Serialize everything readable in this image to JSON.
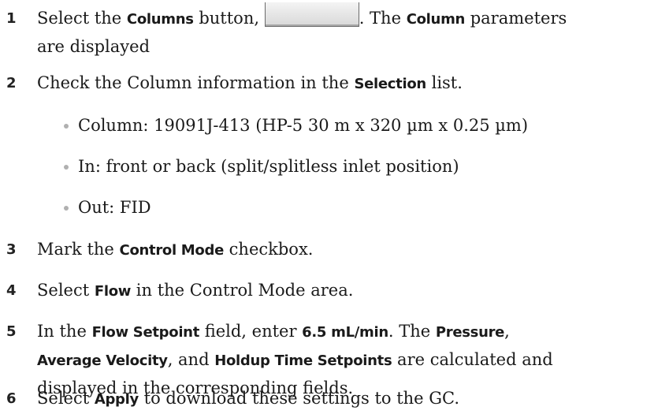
{
  "steps": [
    {
      "num": "1",
      "pre": "Select the ",
      "bold1": "Columns",
      "mid": " button, ",
      "post": ". The ",
      "bold2": "Column",
      "end": " parameters",
      "line2": "are displayed"
    },
    {
      "num": "2",
      "pre": "Check the Column information in the ",
      "bold1": "Selection",
      "end": " list."
    },
    {
      "num": "3",
      "pre": "Mark the ",
      "bold1": "Control Mode",
      "end": " checkbox."
    },
    {
      "num": "4",
      "pre": "Select ",
      "bold1": "Flow",
      "end": " in the Control Mode area."
    },
    {
      "num": "5",
      "pre": "In the ",
      "bold1": "Flow Setpoint",
      "mid1": " field, enter ",
      "bold2": "6.5 mL/min",
      "mid2": ". The ",
      "bold3": "Pressure",
      "mid3": ",",
      "bold4": "Average Velocity",
      "mid4": ", and ",
      "bold5": "Holdup Time Setpoints",
      "mid5": " are calculated and",
      "line3": "displayed in the corresponding fields."
    },
    {
      "num": "6",
      "pre": "Select ",
      "bold1": "Apply",
      "end": " to download these settings to the GC."
    }
  ],
  "bullets": [
    "Column: 19091J-413 (HP-5 30 m x 320 µm x 0.25 µm)",
    "In: front or back (split/splitless inlet position)",
    "Out: FID"
  ],
  "icons": {
    "columns_button": "columns-button-icon"
  }
}
